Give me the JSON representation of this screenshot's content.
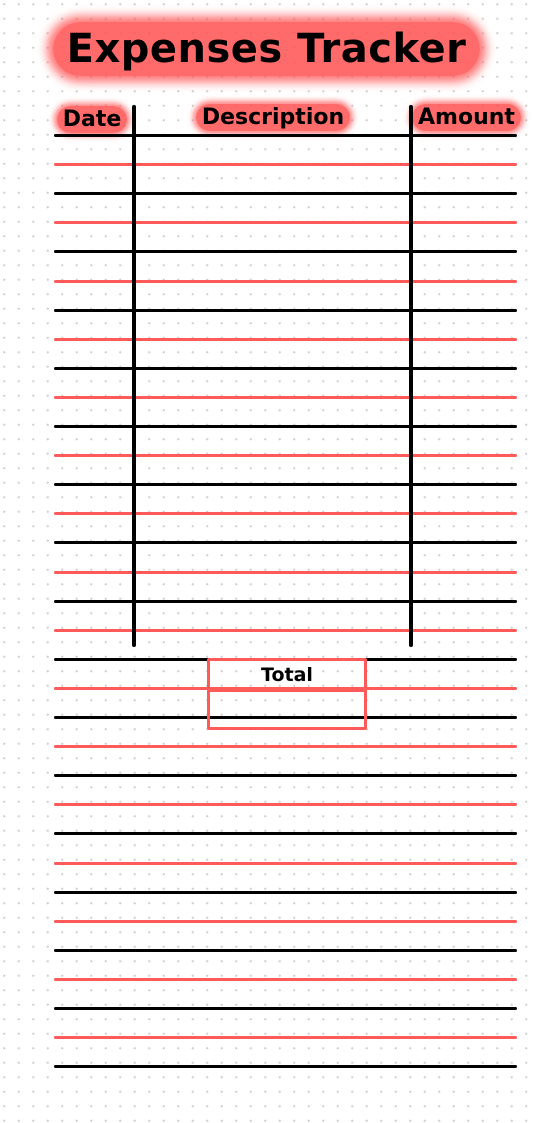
{
  "title": "Expenses Tracker",
  "columns": [
    {
      "label": "Date"
    },
    {
      "label": "Description"
    },
    {
      "label": "Amount"
    }
  ],
  "rows": [
    {
      "date": "",
      "description": "",
      "amount": ""
    },
    {
      "date": "",
      "description": "",
      "amount": ""
    },
    {
      "date": "",
      "description": "",
      "amount": ""
    },
    {
      "date": "",
      "description": "",
      "amount": ""
    },
    {
      "date": "",
      "description": "",
      "amount": ""
    },
    {
      "date": "",
      "description": "",
      "amount": ""
    },
    {
      "date": "",
      "description": "",
      "amount": ""
    },
    {
      "date": "",
      "description": "",
      "amount": ""
    },
    {
      "date": "",
      "description": "",
      "amount": ""
    },
    {
      "date": "",
      "description": "",
      "amount": ""
    },
    {
      "date": "",
      "description": "",
      "amount": ""
    },
    {
      "date": "",
      "description": "",
      "amount": ""
    },
    {
      "date": "",
      "description": "",
      "amount": ""
    },
    {
      "date": "",
      "description": "",
      "amount": ""
    },
    {
      "date": "",
      "description": "",
      "amount": ""
    },
    {
      "date": "",
      "description": "",
      "amount": ""
    },
    {
      "date": "",
      "description": "",
      "amount": ""
    }
  ],
  "total": {
    "label": "Total",
    "value": ""
  },
  "colors": {
    "accent": "#ff5a5a",
    "line_dark": "#000000",
    "dot_grid": "#cfcfcf"
  }
}
